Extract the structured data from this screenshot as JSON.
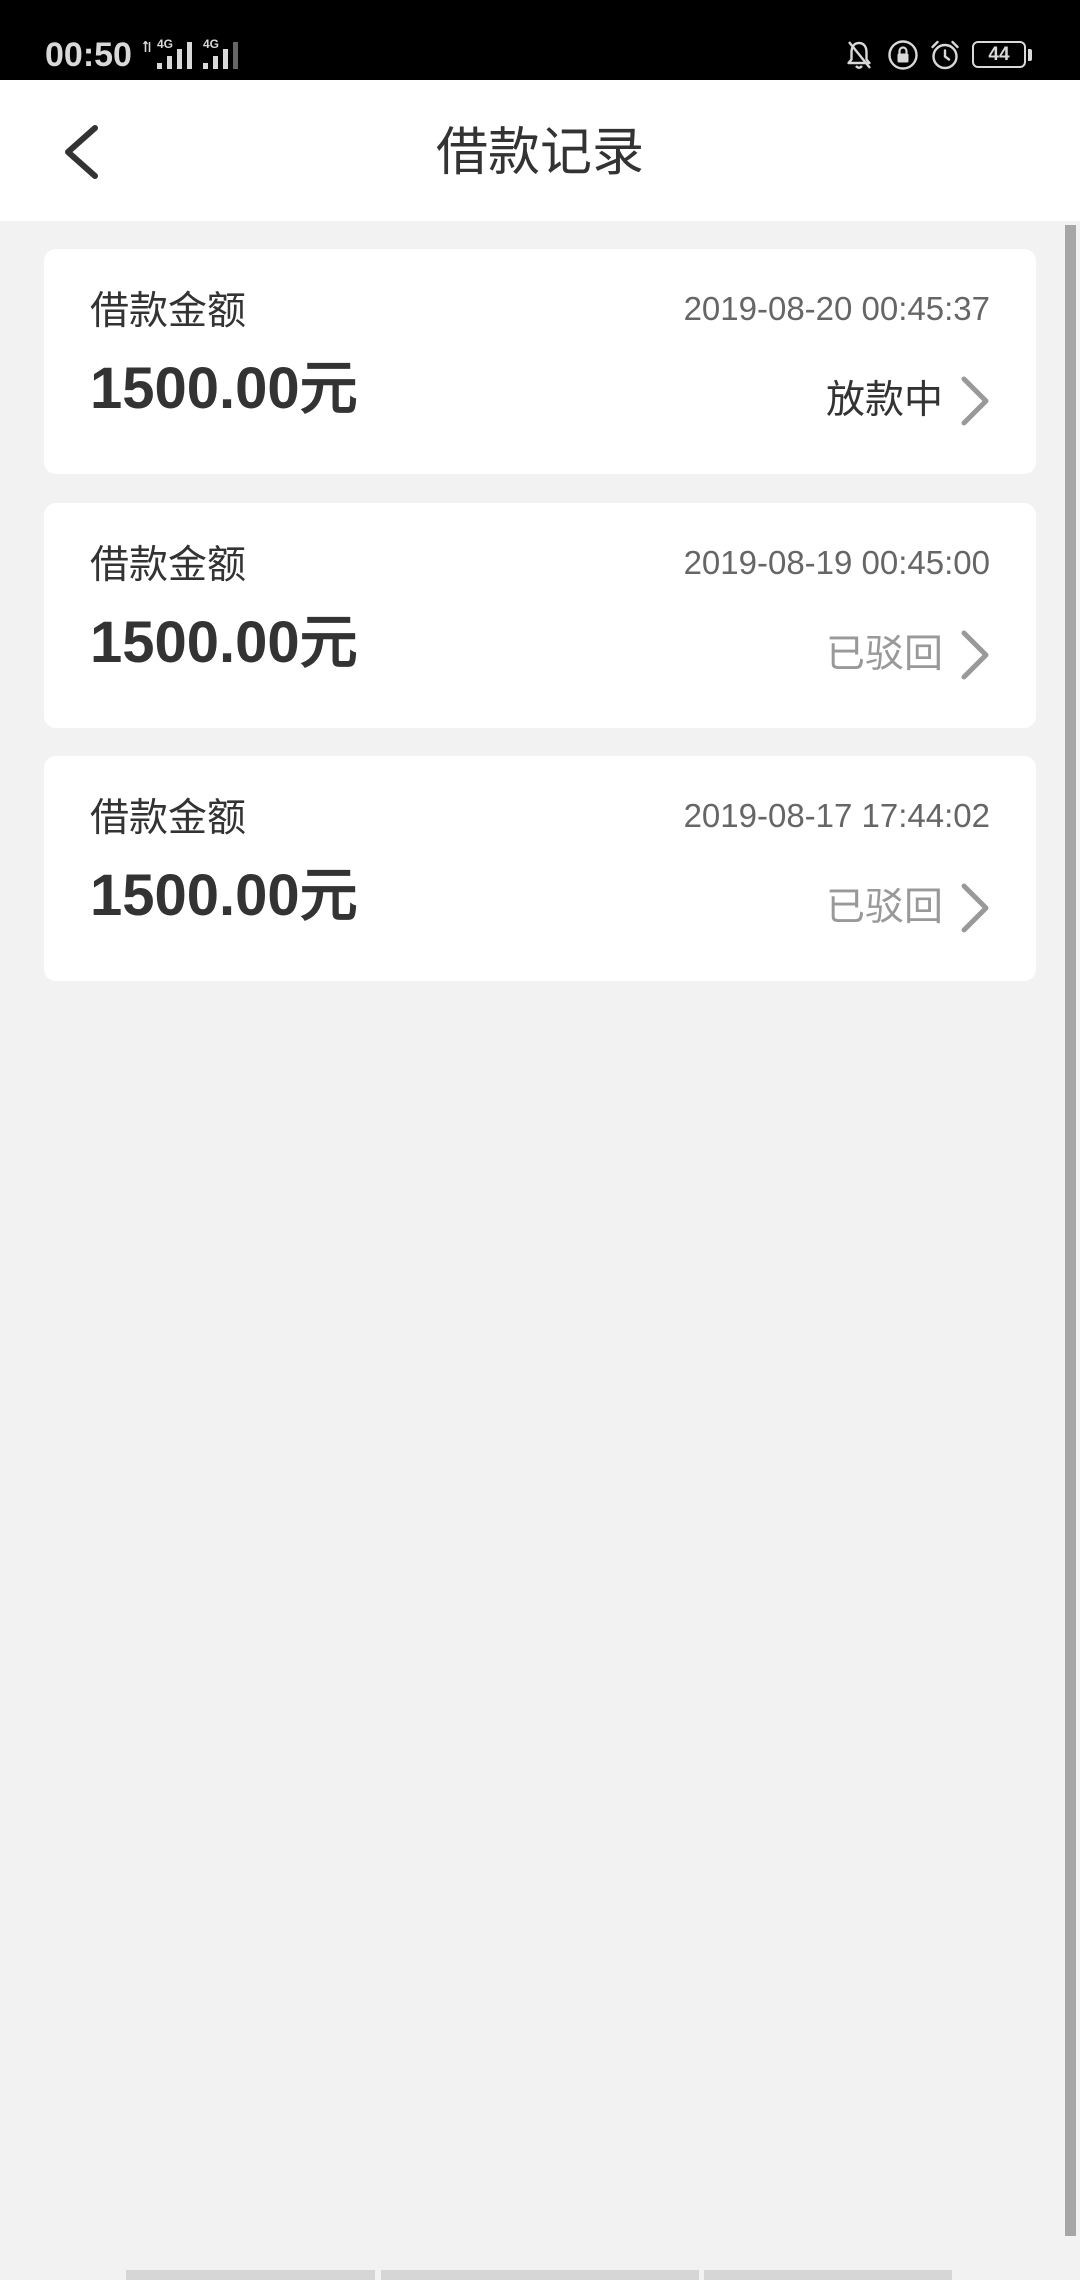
{
  "status_bar": {
    "time": "00:50",
    "sim1_network": "4G",
    "sim2_network": "4G",
    "battery_level": "44",
    "icons": [
      "data-activity-icon",
      "signal-icon",
      "signal-icon",
      "bell-off-icon",
      "lock-icon",
      "alarm-icon",
      "battery-icon"
    ]
  },
  "header": {
    "title": "借款记录",
    "back_icon": "chevron-left-icon"
  },
  "records": [
    {
      "label": "借款金额",
      "amount": "1500.00元",
      "datetime": "2019-08-20 00:45:37",
      "status": "放款中",
      "status_color": "#333333",
      "arrow_icon": "chevron-right-icon"
    },
    {
      "label": "借款金额",
      "amount": "1500.00元",
      "datetime": "2019-08-19 00:45:00",
      "status": "已驳回",
      "status_color": "#999999",
      "arrow_icon": "chevron-right-icon"
    },
    {
      "label": "借款金额",
      "amount": "1500.00元",
      "datetime": "2019-08-17 17:44:02",
      "status": "已驳回",
      "status_color": "#999999",
      "arrow_icon": "chevron-right-icon"
    }
  ],
  "colors": {
    "status_bar_background": "#000000",
    "header_background": "#ffffff",
    "page_background": "#f2f2f2",
    "card_background": "#ffffff",
    "primary_text": "#333333",
    "secondary_text": "#666666",
    "muted_text": "#999999",
    "scrollbar": "#a6a6a6"
  }
}
